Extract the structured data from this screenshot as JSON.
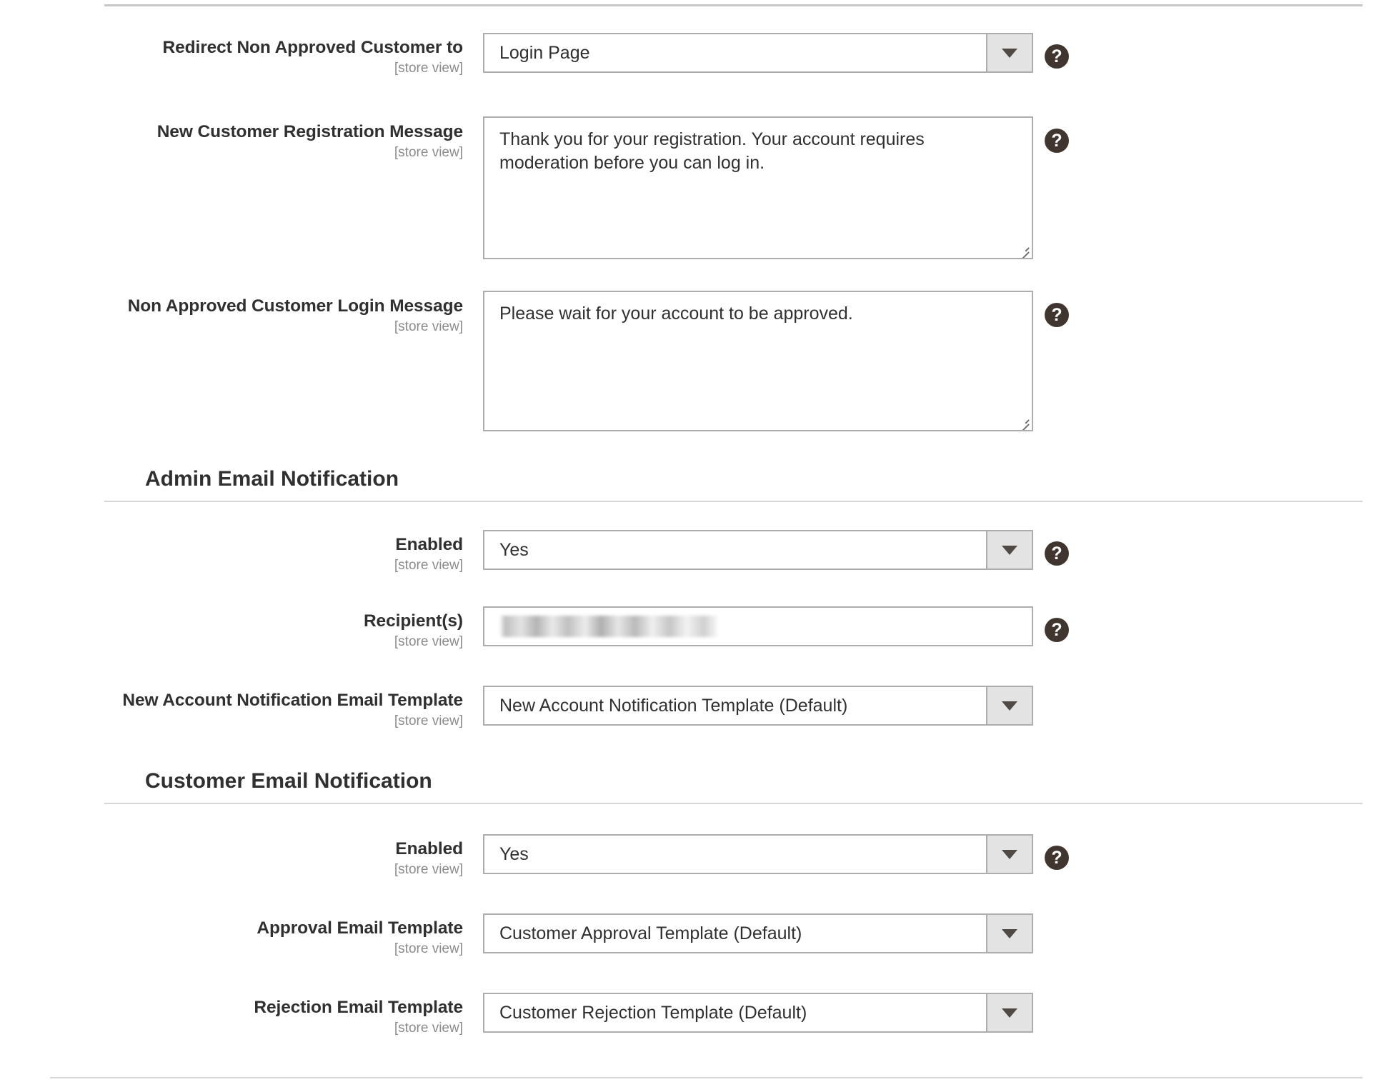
{
  "page": {
    "help_icon_glyph": "?",
    "caret_icon": "chevron-down-icon",
    "colors": {
      "text": "#303030",
      "scope_text": "#8c8c8c",
      "border": "#adadad",
      "rule": "#d6d6d6",
      "help_bubble": "#41362f",
      "select_button": "#e3e3e3"
    }
  },
  "scope_label": "[store view]",
  "fields": {
    "redirect_non_approved_customer_to": {
      "label": "Redirect Non Approved Customer to",
      "scope": "[store view]",
      "type": "select",
      "value": "Login Page",
      "has_help": true
    },
    "new_customer_registration_message": {
      "label": "New Customer Registration Message",
      "scope": "[store view]",
      "type": "textarea",
      "value": "Thank you for your registration. Your account requires moderation before you can log in.",
      "has_help": true
    },
    "non_approved_customer_login_message": {
      "label": "Non Approved Customer Login Message",
      "scope": "[store view]",
      "type": "textarea",
      "value": "Please wait for your account to be approved.",
      "has_help": true
    },
    "admin_enabled": {
      "label": "Enabled",
      "scope": "[store view]",
      "type": "select",
      "value": "Yes",
      "has_help": true
    },
    "admin_recipients": {
      "label": "Recipient(s)",
      "scope": "[store view]",
      "type": "text",
      "value": "",
      "redacted": true,
      "has_help": true
    },
    "new_account_notification_email_template": {
      "label": "New Account Notification Email Template",
      "scope": "[store view]",
      "type": "select",
      "value": "New Account Notification Template (Default)",
      "has_help": false
    },
    "customer_enabled": {
      "label": "Enabled",
      "scope": "[store view]",
      "type": "select",
      "value": "Yes",
      "has_help": true
    },
    "approval_email_template": {
      "label": "Approval Email Template",
      "scope": "[store view]",
      "type": "select",
      "value": "Customer Approval Template (Default)",
      "has_help": false
    },
    "rejection_email_template": {
      "label": "Rejection Email Template",
      "scope": "[store view]",
      "type": "select",
      "value": "Customer Rejection Template (Default)",
      "has_help": false
    }
  },
  "sections": {
    "admin_email_notification": {
      "title": "Admin Email Notification"
    },
    "customer_email_notification": {
      "title": "Customer Email Notification"
    }
  }
}
